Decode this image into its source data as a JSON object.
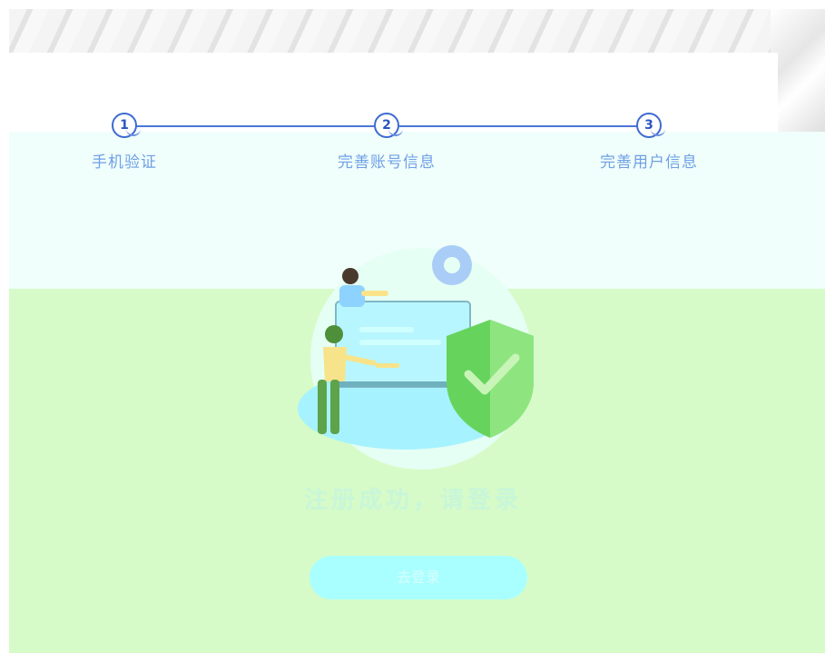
{
  "steps": [
    {
      "number": "1",
      "label": "手机验证"
    },
    {
      "number": "2",
      "label": "完善账号信息"
    },
    {
      "number": "3",
      "label": "完善用户信息"
    }
  ],
  "result": {
    "title": "注册成功，请登录",
    "button_label": "去登录"
  },
  "colors": {
    "accent": "#3d6ad2",
    "step_label": "#6fa0e6",
    "shield": "#66d35d",
    "button": "#a9ffff",
    "green_tint": "#d6fbc8",
    "cyan_tint": "#f0fffb"
  },
  "icons": [
    "gear-icon",
    "shield-check-icon"
  ]
}
